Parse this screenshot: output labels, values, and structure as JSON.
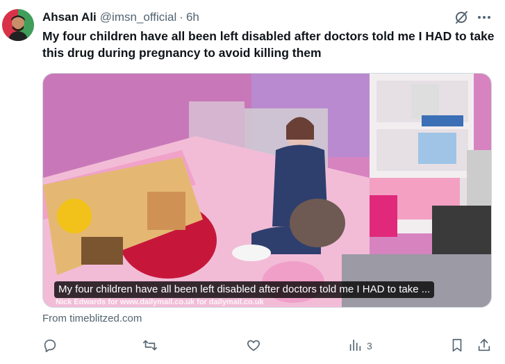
{
  "tweet": {
    "author_name": "Ahsan Ali",
    "author_handle": "@imsn_official",
    "separator": "·",
    "time": "6h",
    "text": "My four children have all been left disabled after doctors told me I HAD to take this drug during pregnancy to avoid killing them",
    "card": {
      "caption": "My four children have all been left disabled after doctors told me I HAD to take ...",
      "credit": "Nick Edwards for www.dailymail.co.uk for dailymail.co.uk"
    },
    "source": "From timeblitzed.com",
    "stats": {
      "views": "3"
    }
  },
  "icons": {
    "grok": "grok-icon",
    "more": "more-icon",
    "reply": "reply-icon",
    "retweet": "retweet-icon",
    "like": "like-icon",
    "views": "views-icon",
    "bookmark": "bookmark-icon",
    "share": "share-icon"
  },
  "colors": {
    "text_primary": "#0f1419",
    "text_secondary": "#536471",
    "border": "#cfd9de"
  }
}
